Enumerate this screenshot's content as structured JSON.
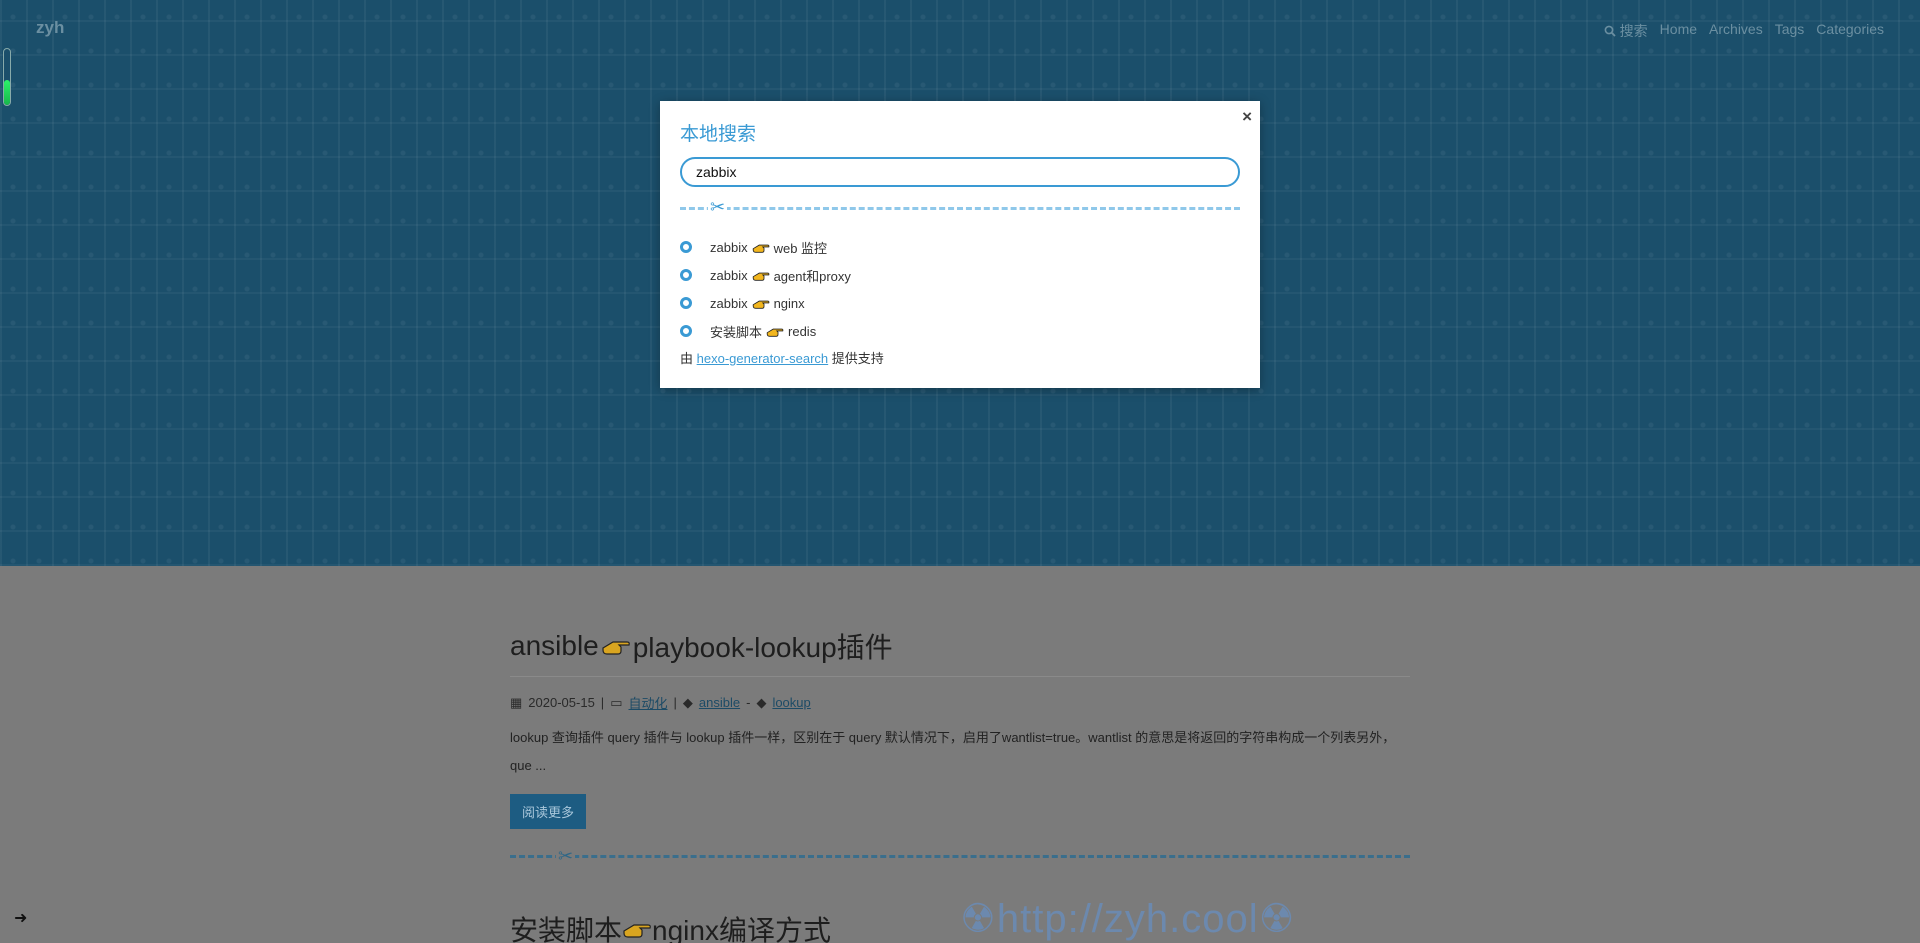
{
  "header": {
    "brand": "zyh",
    "nav": {
      "search_label": "搜索",
      "items": [
        "Home",
        "Archives",
        "Tags",
        "Categories"
      ]
    },
    "reading_progress_percent": 45
  },
  "post1": {
    "title_part1": "ansible",
    "title_part2": "playbook-lookup插件",
    "date": "2020-05-15",
    "category": "自动化",
    "tags": [
      "ansible",
      "lookup"
    ],
    "tag_separator": "-",
    "meta_separator": "|",
    "excerpt": "lookup 查询插件 query 插件与 lookup 插件一样，区别在于 query 默认情况下，启用了wantlist=true。wantlist 的意思是将返回的字符串构成一个列表另外，que ...",
    "read_more": "阅读更多"
  },
  "post2": {
    "title_part1": "安装脚本",
    "title_part2": "nginx编译方式"
  },
  "watermark": "☢http://zyh.cool☢",
  "search_modal": {
    "title": "本地搜索",
    "close": "×",
    "query": "zabbix",
    "results": [
      {
        "before": "zabbix",
        "after": "web 监控"
      },
      {
        "before": "zabbix",
        "after": "agent和proxy"
      },
      {
        "before": "zabbix",
        "after": "nginx"
      },
      {
        "before": "安装脚本",
        "after": "redis"
      }
    ],
    "powered_prefix": "由",
    "powered_link": "hexo-generator-search",
    "powered_suffix": "提供支持"
  },
  "colors": {
    "accent": "#3a9ad4",
    "hero_bg": "#1b4f6b",
    "page_dim": "#7b7b7b"
  },
  "icons": [
    "search-icon",
    "calendar-icon",
    "folder-icon",
    "tag-icon",
    "scissors-icon",
    "hand-pointing-icon",
    "close-icon",
    "arrow-right-icon"
  ]
}
